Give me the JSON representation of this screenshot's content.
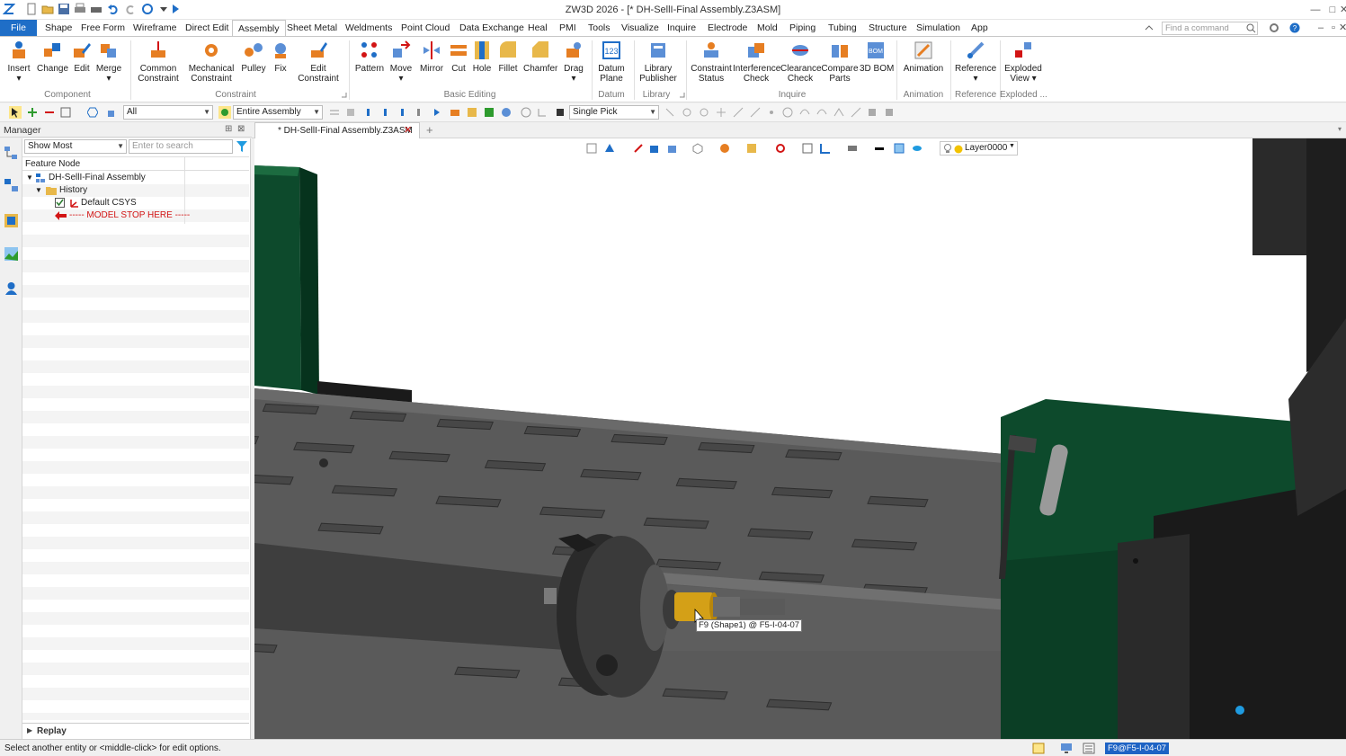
{
  "window": {
    "title": "ZW3D 2026 - [* DH-SellI-Final Assembly.Z3ASM]"
  },
  "menu": {
    "tabs": [
      "File",
      "Shape",
      "Free Form",
      "Wireframe",
      "Direct Edit",
      "Assembly",
      "Sheet Metal",
      "Weldments",
      "Point Cloud",
      "Data Exchange",
      "Heal",
      "PMI",
      "Tools",
      "Visualize",
      "Inquire",
      "Electrode",
      "Mold",
      "Piping",
      "Tubing",
      "Structure",
      "Simulation",
      "App"
    ],
    "active": "Assembly",
    "search_placeholder": "Find a command"
  },
  "ribbon": {
    "buttons": [
      {
        "name": "insert",
        "label": "Insert",
        "has_dropdown": true
      },
      {
        "name": "change",
        "label": "Change"
      },
      {
        "name": "edit",
        "label": "Edit"
      },
      {
        "name": "merge",
        "label": "Merge",
        "has_dropdown": true
      },
      {
        "name": "common-constraint",
        "label": "Common\nConstraint"
      },
      {
        "name": "mechanical-constraint",
        "label": "Mechanical\nConstraint"
      },
      {
        "name": "pulley",
        "label": "Pulley"
      },
      {
        "name": "fix",
        "label": "Fix"
      },
      {
        "name": "edit-constraint",
        "label": "Edit\nConstraint"
      },
      {
        "name": "pattern",
        "label": "Pattern"
      },
      {
        "name": "move",
        "label": "Move",
        "has_dropdown": true
      },
      {
        "name": "mirror",
        "label": "Mirror"
      },
      {
        "name": "cut",
        "label": "Cut"
      },
      {
        "name": "hole",
        "label": "Hole"
      },
      {
        "name": "fillet",
        "label": "Fillet"
      },
      {
        "name": "chamfer",
        "label": "Chamfer"
      },
      {
        "name": "drag",
        "label": "Drag",
        "has_dropdown": true
      },
      {
        "name": "datum-plane",
        "label": "Datum\nPlane"
      },
      {
        "name": "library-publisher",
        "label": "Library\nPublisher"
      },
      {
        "name": "constraint-status",
        "label": "Constraint\nStatus"
      },
      {
        "name": "interference-check",
        "label": "Interference\nCheck"
      },
      {
        "name": "clearance-check",
        "label": "Clearance\nCheck"
      },
      {
        "name": "compare-parts",
        "label": "Compare\nParts"
      },
      {
        "name": "3d-bom",
        "label": "3D BOM"
      },
      {
        "name": "animation",
        "label": "Animation"
      },
      {
        "name": "reference",
        "label": "Reference"
      },
      {
        "name": "exploded-view",
        "label": "Exploded\nView"
      }
    ],
    "groups": [
      "Component",
      "Constraint",
      "Basic Editing",
      "Datum",
      "Library",
      "Inquire",
      "Animation",
      "Reference",
      "Exploded ..."
    ]
  },
  "toolbar": {
    "filter_value": "All",
    "scope_value": "Entire Assembly",
    "pick_value": "Single Pick"
  },
  "manager": {
    "title": "Manager",
    "filter_value": "Show Most",
    "search_placeholder": "Enter to search",
    "column_header": "Feature Node",
    "tree": [
      {
        "label": "DH-SellI-Final Assembly",
        "level": 0
      },
      {
        "label": "History",
        "level": 1
      },
      {
        "label": "Default CSYS",
        "level": 2,
        "checked": true
      },
      {
        "label": "----- MODEL STOP HERE -----",
        "level": 2,
        "stop": true
      }
    ],
    "replay_label": "Replay"
  },
  "document": {
    "tab_label": "* DH-SellI-Final Assembly.Z3ASM",
    "layer": "Layer0000",
    "tooltip": "F9 (Shape1) @ F5-I-04-07"
  },
  "status": {
    "message": "Select another entity or <middle-click> for edit options.",
    "selection": "F9@F5-I-04-07"
  },
  "colors": {
    "accent": "#1f6ec7",
    "deck": "#5a5a5a",
    "green_part": "#0d4a2c",
    "highlight": "#d4a017",
    "stop_text": "#d21414"
  }
}
